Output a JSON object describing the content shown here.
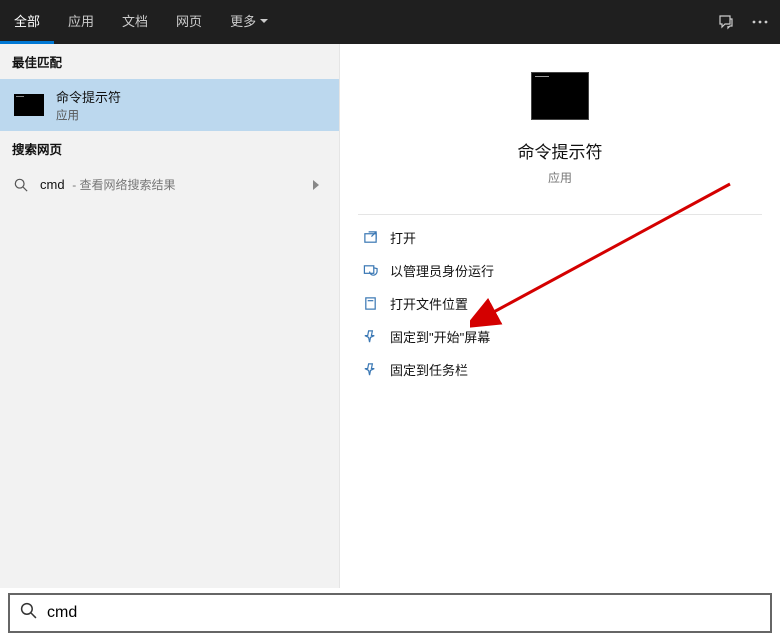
{
  "tabs": {
    "all": "全部",
    "apps": "应用",
    "docs": "文档",
    "web": "网页",
    "more": "更多"
  },
  "left": {
    "best_match_hdr": "最佳匹配",
    "result_title": "命令提示符",
    "result_sub": "应用",
    "web_hdr": "搜索网页",
    "web_query": "cmd",
    "web_sub": "- 查看网络搜索结果"
  },
  "detail": {
    "title": "命令提示符",
    "sub": "应用",
    "actions": {
      "open": "打开",
      "admin": "以管理员身份运行",
      "open_loc": "打开文件位置",
      "pin_start": "固定到\"开始\"屏幕",
      "pin_task": "固定到任务栏"
    }
  },
  "search": {
    "value": "cmd"
  }
}
